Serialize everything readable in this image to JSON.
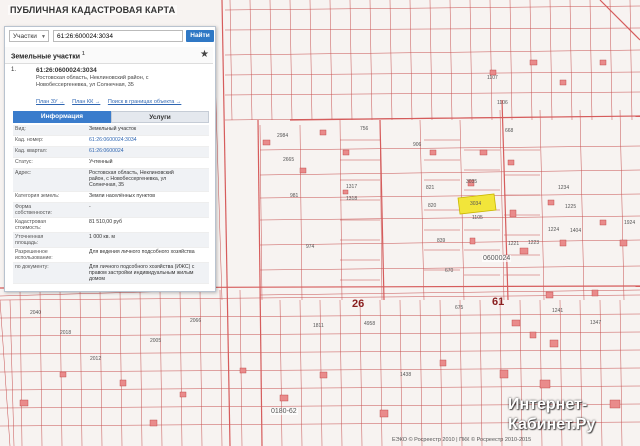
{
  "app": {
    "title": "ПУБЛИЧНАЯ КАДАСТРОВАЯ КАРТА"
  },
  "search": {
    "type_label": "Участки",
    "query": "61:26:600024:3034",
    "button_label": "Найти"
  },
  "panel": {
    "section_title": "Земельные участки",
    "section_count": "1",
    "result": {
      "index": "1.",
      "number": "61:26:0600024:3034",
      "address": "Ростовская область, Неклиновский район, с Новобессергеневка, ул Солнечная, 35",
      "links": [
        "План ЗУ →",
        "План КК →",
        "Поиск в границах объекта →"
      ]
    },
    "tabs": {
      "active": "Информация",
      "inactive": "Услуги"
    },
    "info_rows": [
      {
        "label": "Вид:",
        "value": "Земельный участок"
      },
      {
        "label": "Кад. номер:",
        "value": "61:26:0600024:3034"
      },
      {
        "label": "Кад. квартал:",
        "value": "61:26:0600024"
      },
      {
        "label": "Статус:",
        "value": "Учтенный"
      },
      {
        "label": "Адрес:",
        "value": "Ростовская область, Неклиновский район, с Новобессергеневка, ул Солнечная, 35"
      },
      {
        "label": "Категория земель:",
        "value": "Земли населённых пунктов"
      },
      {
        "label": "Форма собственности:",
        "value": "-"
      },
      {
        "label": "Кадастровая стоимость:",
        "value": "81 510,00 руб"
      },
      {
        "label": "Уточненная площадь:",
        "value": "1 000 кв. м"
      },
      {
        "label": "Разрешенное использование:",
        "value": "Для ведения личного подсобного хозяйства"
      },
      {
        "label": "по документу:",
        "value": "Для личного подсобного хозяйства (ИЖС) с правом застройки индивидуальным жилым домом"
      }
    ]
  },
  "map": {
    "labels": [
      "26",
      "61",
      "0180-62",
      "0600024",
      "1107",
      "1106",
      "668",
      "1224",
      "1225",
      "1234",
      "1223",
      "1222",
      "1404",
      "1924",
      "3035",
      "3034",
      "1105",
      "839",
      "670",
      "675",
      "820",
      "821",
      "906",
      "2984",
      "2665",
      "981",
      "756",
      "1811",
      "974",
      "4958",
      "1317",
      "1318",
      "1219",
      "1221",
      "1241",
      "1242",
      "1347",
      "1408",
      "1412",
      "1418",
      "1438",
      "1459",
      "1554",
      "1559",
      "2005",
      "2012",
      "2018",
      "2023",
      "2040",
      "2042",
      "2066",
      "2098"
    ]
  },
  "watermark": {
    "line1": "Интернет-",
    "line2": "Кабинет.Ру"
  },
  "copyright": "ЕЭКО © Росреестр 2010 | ПКК © Росреестр 2010-2015",
  "colors": {
    "accent": "#2f78c5",
    "parcel_border": "#c63c3c",
    "selected_parcel": "#f2e53a",
    "building_fill": "#e98b8b"
  }
}
